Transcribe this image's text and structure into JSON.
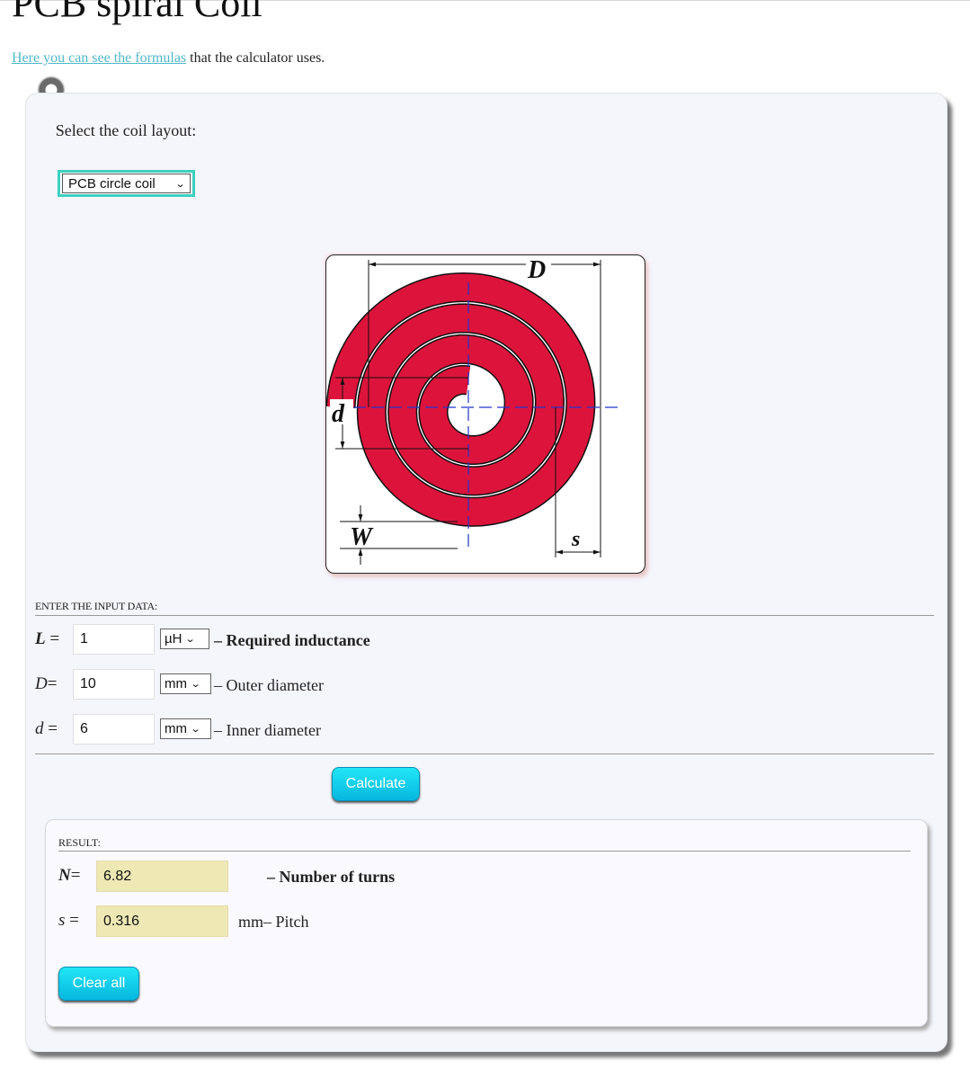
{
  "page": {
    "title": "PCB spiral Coil",
    "intro_link": "Here you can see the formulas",
    "intro_rest": " that the calculator uses."
  },
  "layout": {
    "label": "Select the coil layout:",
    "selected": "PCB circle coil"
  },
  "diagram": {
    "label_outer": "D",
    "label_inner": "d",
    "label_width": "W",
    "label_spacing": "s",
    "trace_color": "#dc143c"
  },
  "inputs": {
    "section_label": "ENTER THE INPUT DATA:",
    "fields": [
      {
        "symbol": "L",
        "eq": "=",
        "value": "1",
        "unit": "µH",
        "description": "– Required inductance"
      },
      {
        "symbol": "D",
        "eq": "=",
        "value": "10",
        "unit": "mm",
        "description": "– Outer diameter"
      },
      {
        "symbol": "d",
        "eq": "=",
        "value": "6",
        "unit": "mm",
        "description": "– Inner diameter"
      }
    ],
    "calculate_label": "Calculate"
  },
  "results": {
    "section_label": "RESULT:",
    "rows": [
      {
        "symbol": "N",
        "eq": "=",
        "value": "6.82",
        "unit": "",
        "description": "– Number of turns"
      },
      {
        "symbol": "s",
        "eq": "=",
        "value": "0.316",
        "unit": "mm",
        "description": "– Pitch"
      }
    ],
    "clear_label": "Clear all"
  },
  "colors": {
    "accent": "#05b7de",
    "select_border": "#3cd0c0",
    "result_field": "#eee8b4",
    "link": "#4fb8c8"
  }
}
